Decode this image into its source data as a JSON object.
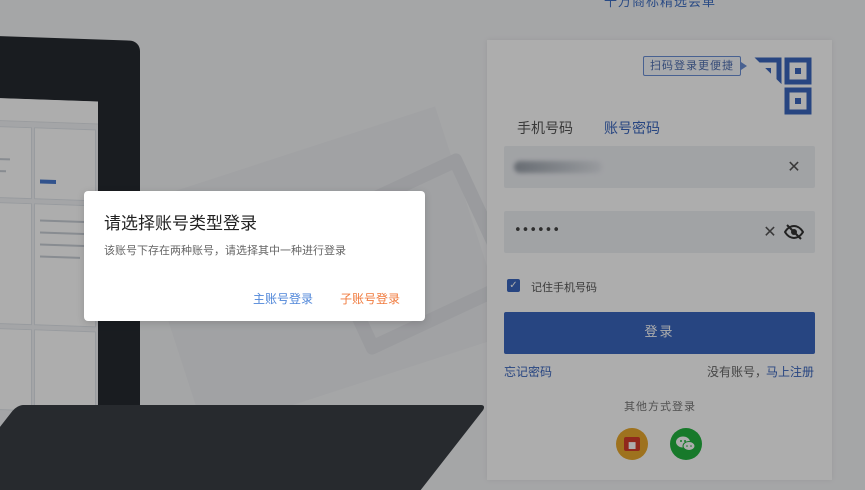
{
  "top_banner": {
    "text": "千万商标精选会革"
  },
  "login_card": {
    "qr_hint": "扫码登录更便捷",
    "tabs": {
      "phone": "手机号码",
      "account": "账号密码"
    },
    "username_value": "",
    "password_value": "••••••",
    "remember_label": "记住手机号码",
    "login_button": "登录",
    "forgot_password": "忘记密码",
    "no_account": "没有账号，",
    "register": "马上注册",
    "other_login": "其他方式登录"
  },
  "dialog": {
    "title": "请选择账号类型登录",
    "message": "该账号下存在两种账号，请选择其中一种进行登录",
    "main_account_button": "主账号登录",
    "sub_account_button": "子账号登录"
  },
  "colors": {
    "primary": "#3a66be",
    "main_button": "#4f86d9",
    "sub_button": "#f07a3d",
    "wechat": "#22b33f",
    "other_social": "#e9a92d"
  },
  "icons": {
    "qr": "qr-code-icon",
    "clear": "close-icon",
    "eye": "eye-slash-icon",
    "check": "check-icon",
    "social_1": "social-login-icon",
    "social_2": "wechat-icon"
  }
}
